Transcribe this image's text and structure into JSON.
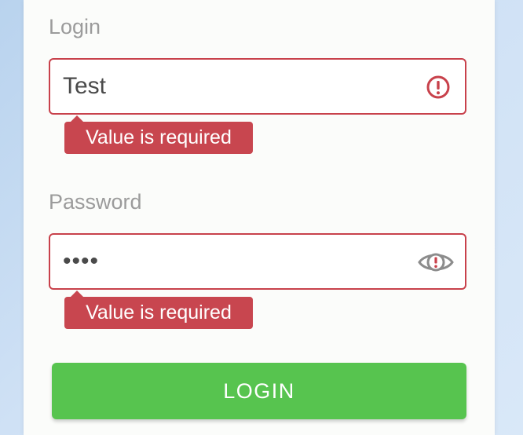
{
  "login_field": {
    "label": "Login",
    "value": "Test",
    "error": "Value is required"
  },
  "password_field": {
    "label": "Password",
    "value": "test",
    "error": "Value is required"
  },
  "login_button": {
    "label": "LOGIN"
  },
  "colors": {
    "error": "#c8414b",
    "button": "#57c44f",
    "label": "#9b9b9b"
  }
}
